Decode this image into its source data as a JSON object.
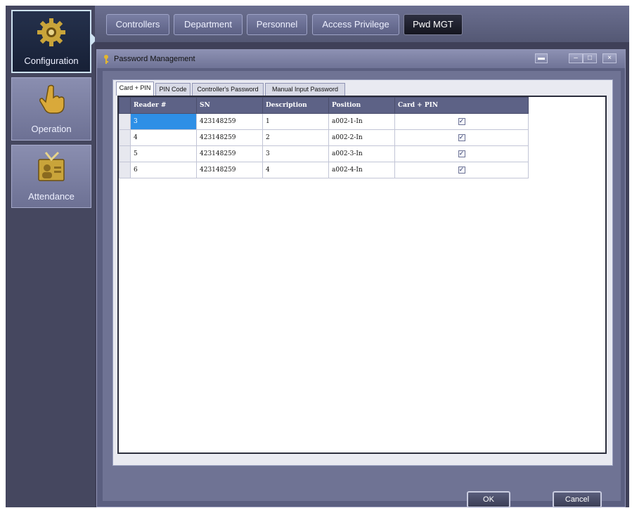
{
  "sidebar": {
    "items": [
      {
        "label": "Configuration",
        "icon": "gear-icon"
      },
      {
        "label": "Operation",
        "icon": "hand-pointer-icon"
      },
      {
        "label": "Attendance",
        "icon": "attendance-icon"
      }
    ]
  },
  "topnav": {
    "tabs": [
      "Controllers",
      "Department",
      "Personnel",
      "Access Privilege",
      "Pwd MGT"
    ],
    "active": "Pwd MGT"
  },
  "window": {
    "title": "Password Management",
    "icon": "key-icon",
    "controls": [
      "minimize",
      "maximize",
      "close"
    ]
  },
  "inner_tabs": [
    "Card + PIN",
    "PIN Code",
    "Controller's Password",
    "Manual Input Password"
  ],
  "grid": {
    "headers": [
      "Reader #",
      "SN",
      "Description",
      "Position",
      "Card + PIN"
    ],
    "rows": [
      {
        "reader": "3",
        "sn": "423148259",
        "description": "1",
        "position": "a002-1-In",
        "card_pin": true
      },
      {
        "reader": "4",
        "sn": "423148259",
        "description": "2",
        "position": "a002-2-In",
        "card_pin": true
      },
      {
        "reader": "5",
        "sn": "423148259",
        "description": "3",
        "position": "a002-3-In",
        "card_pin": true
      },
      {
        "reader": "6",
        "sn": "423148259",
        "description": "4",
        "position": "a002-4-In",
        "card_pin": true
      }
    ]
  },
  "buttons": {
    "ok": "OK",
    "cancel": "Cancel"
  },
  "colors": {
    "frame": "#3f4058",
    "panel": "#6f7394",
    "selection": "#2e8fe6",
    "header": "#5d6286"
  }
}
